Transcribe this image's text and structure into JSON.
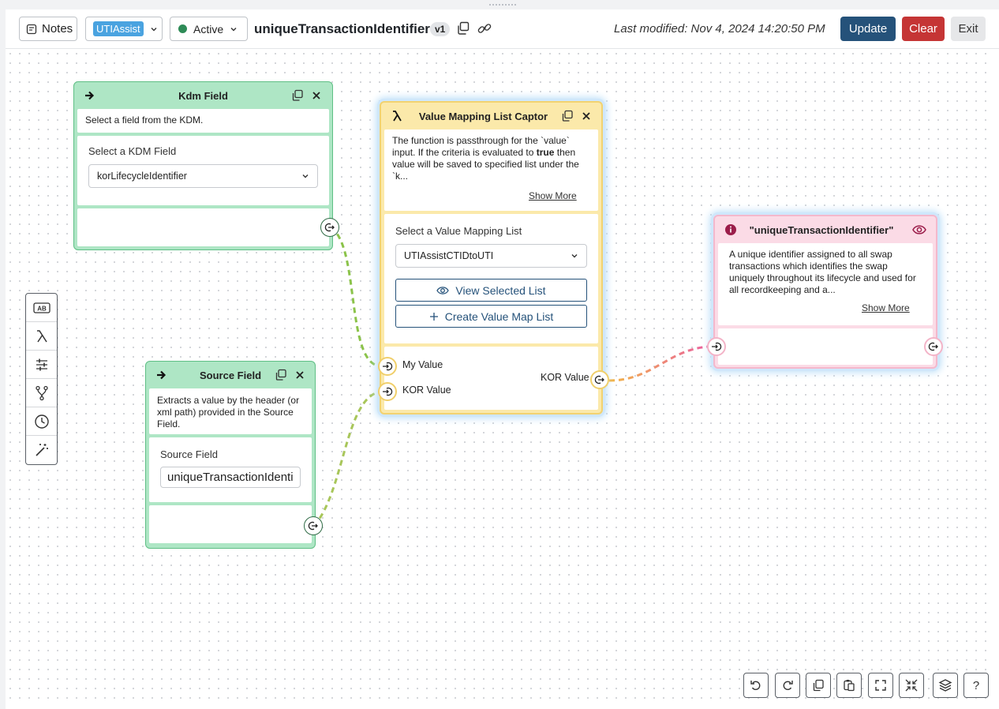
{
  "header": {
    "notes_label": "Notes",
    "app_badge": "UTIAssist",
    "status_label": "Active",
    "title": "uniqueTransactionIdentifier",
    "version": "v1",
    "last_modified": "Last modified: Nov 4, 2024 14:20:50 PM",
    "update_label": "Update",
    "clear_label": "Clear",
    "exit_label": "Exit"
  },
  "nodes": {
    "kdm": {
      "title": "Kdm Field",
      "description": "Select a field from the KDM.",
      "field_label": "Select a KDM Field",
      "selected_value": "korLifecycleIdentifier"
    },
    "source": {
      "title": "Source Field",
      "description": "Extracts a value by the header (or xml path) provided in the Source Field.",
      "field_label": "Source Field",
      "input_value": "uniqueTransactionIdenti"
    },
    "captor": {
      "title": "Value Mapping List Captor",
      "desc_part1": "The function is passthrough for the `value` input. If the criteria is evaluated to ",
      "desc_bold": "true",
      "desc_part2": " then value will be saved to specified list under the `k...",
      "show_more": "Show More",
      "field_label": "Select a Value Mapping List",
      "selected_value": "UTIAssistCTIDtoUTI",
      "view_button": "View Selected List",
      "create_button": "Create Value Map List",
      "input1": "My Value",
      "input2": "KOR Value",
      "output": "KOR Value"
    },
    "output_node": {
      "title": "\"uniqueTransactionIdentifier\"",
      "description": "A unique identifier assigned to all swap transactions which identifies the swap uniquely throughout its lifecycle and used for all recordkeeping and a...",
      "show_more": "Show More"
    }
  },
  "left_toolbar": [
    "text-ab-icon",
    "lambda-icon",
    "sliders-icon",
    "branch-icon",
    "clock-icon",
    "magic-wand-icon"
  ],
  "bottom_toolbar": [
    "undo-icon",
    "redo-icon",
    "copy-icon",
    "paste-icon",
    "fit-view-icon",
    "collapse-icon",
    "layers-icon",
    "help-icon"
  ],
  "help_label": "?",
  "colors": {
    "green": "#aee6c5",
    "yellow": "#fbe9aa",
    "pink": "#fbdbe6",
    "primary": "#25527a",
    "danger": "#c53535"
  }
}
